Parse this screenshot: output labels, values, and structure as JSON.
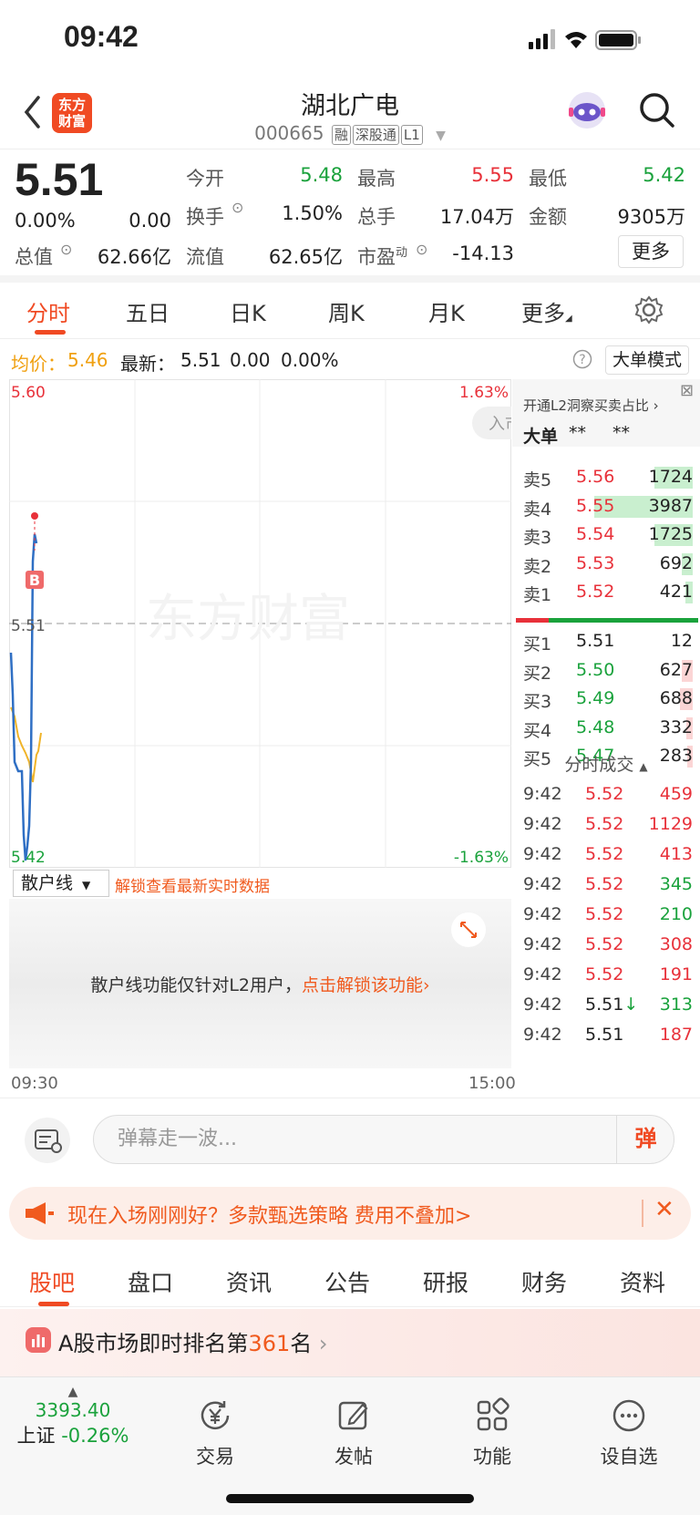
{
  "status_bar": {
    "time": "09:42"
  },
  "header": {
    "stock_name": "湖北广电",
    "stock_code": "000665",
    "tags": [
      "融",
      "深股通",
      "L1"
    ],
    "logo_line1": "东方",
    "logo_line2": "财富"
  },
  "quote": {
    "price": "5.51",
    "change_pct": "0.00%",
    "change": "0.00",
    "open_label": "今开",
    "open": "5.48",
    "high_label": "最高",
    "high": "5.55",
    "low_label": "最低",
    "low": "5.42",
    "turnover_label": "换手",
    "turnover": "1.50%",
    "volume_label": "总手",
    "volume": "17.04万",
    "amount_label": "金额",
    "amount": "9305万",
    "mcap_label": "总值",
    "mcap": "62.66亿",
    "float_label": "流值",
    "float": "62.65亿",
    "pe_label": "市盈",
    "pe_sup": "动",
    "pe": "-14.13",
    "more_label": "更多"
  },
  "chart_tabs": [
    "分时",
    "五日",
    "日K",
    "周K",
    "月K",
    "更多"
  ],
  "infobar": {
    "avg_label": "均价：",
    "avg": "5.46",
    "latest_label": "最新：",
    "latest": "5.51",
    "latest_change": "0.00",
    "latest_pct": "0.00%",
    "big_order_label": "大单模式"
  },
  "chart": {
    "y_max": "5.60",
    "y_min": "5.42",
    "y_mid": "5.51",
    "pct_max": "1.63%",
    "pct_min": "-1.63%",
    "watermark": "东方财富",
    "b_marker": "B",
    "enter_label": "入市",
    "time_start": "09:30",
    "time_end": "15:00"
  },
  "orderbook": {
    "title": "开通L2洞察买卖占比",
    "big_label": "大单",
    "big_v1": "**",
    "big_v2": "**",
    "asks": [
      {
        "label": "卖5",
        "price": "5.56",
        "vol": "1724",
        "bar": 0.35
      },
      {
        "label": "卖4",
        "price": "5.55",
        "vol": "3987",
        "bar": 0.9
      },
      {
        "label": "卖3",
        "price": "5.54",
        "vol": "1725",
        "bar": 0.35
      },
      {
        "label": "卖2",
        "price": "5.53",
        "vol": "692",
        "bar": 0.1
      },
      {
        "label": "卖1",
        "price": "5.52",
        "vol": "421",
        "bar": 0.07
      }
    ],
    "bids": [
      {
        "label": "买1",
        "price": "5.51",
        "vol": "12",
        "bar": 0.0
      },
      {
        "label": "买2",
        "price": "5.50",
        "vol": "627",
        "bar": 0.1
      },
      {
        "label": "买3",
        "price": "5.49",
        "vol": "688",
        "bar": 0.12
      },
      {
        "label": "买4",
        "price": "5.48",
        "vol": "332",
        "bar": 0.06
      },
      {
        "label": "买5",
        "price": "5.47",
        "vol": "283",
        "bar": 0.05
      }
    ],
    "trades_title": "分时成交",
    "trades": [
      {
        "time": "9:42",
        "price": "5.52",
        "vol": "459",
        "dir": "up"
      },
      {
        "time": "9:42",
        "price": "5.52",
        "vol": "1129",
        "dir": "up"
      },
      {
        "time": "9:42",
        "price": "5.52",
        "vol": "413",
        "dir": "up"
      },
      {
        "time": "9:42",
        "price": "5.52",
        "vol": "345",
        "dir": "down"
      },
      {
        "time": "9:42",
        "price": "5.52",
        "vol": "210",
        "dir": "down"
      },
      {
        "time": "9:42",
        "price": "5.52",
        "vol": "308",
        "dir": "up"
      },
      {
        "time": "9:42",
        "price": "5.52",
        "vol": "191",
        "dir": "up"
      },
      {
        "time": "9:42",
        "price": "5.51",
        "arrow": "↓",
        "vol": "313",
        "dir": "down"
      },
      {
        "time": "9:42",
        "price": "5.51",
        "vol": "187",
        "dir": "up"
      }
    ]
  },
  "retail": {
    "select_label": "散户线",
    "hint": "解锁查看最新实时数据",
    "msg_prefix": "散户线功能仅针对L2用户，",
    "msg_link": "点击解锁该功能"
  },
  "comment": {
    "placeholder": "弹幕走一波...",
    "danmu_label": "弹"
  },
  "promo": {
    "text": "现在入场刚刚好？多款甄选策略 费用不叠加>"
  },
  "bottom_tabs": [
    "股吧",
    "盘口",
    "资讯",
    "公告",
    "研报",
    "财务",
    "资料"
  ],
  "ranking": {
    "prefix": "A股市场即时排名第",
    "rank": "361",
    "suffix": "名"
  },
  "bottom_nav": {
    "index_value": "3393.40",
    "index_name": "上证",
    "index_change": "-0.26%",
    "items": [
      "交易",
      "发帖",
      "功能",
      "设自选"
    ]
  },
  "colors": {
    "up": "#e8313a",
    "down": "#1aa23c",
    "accent": "#f04a23",
    "avg_line": "#f0b429",
    "price_line": "#2f6fc4"
  }
}
